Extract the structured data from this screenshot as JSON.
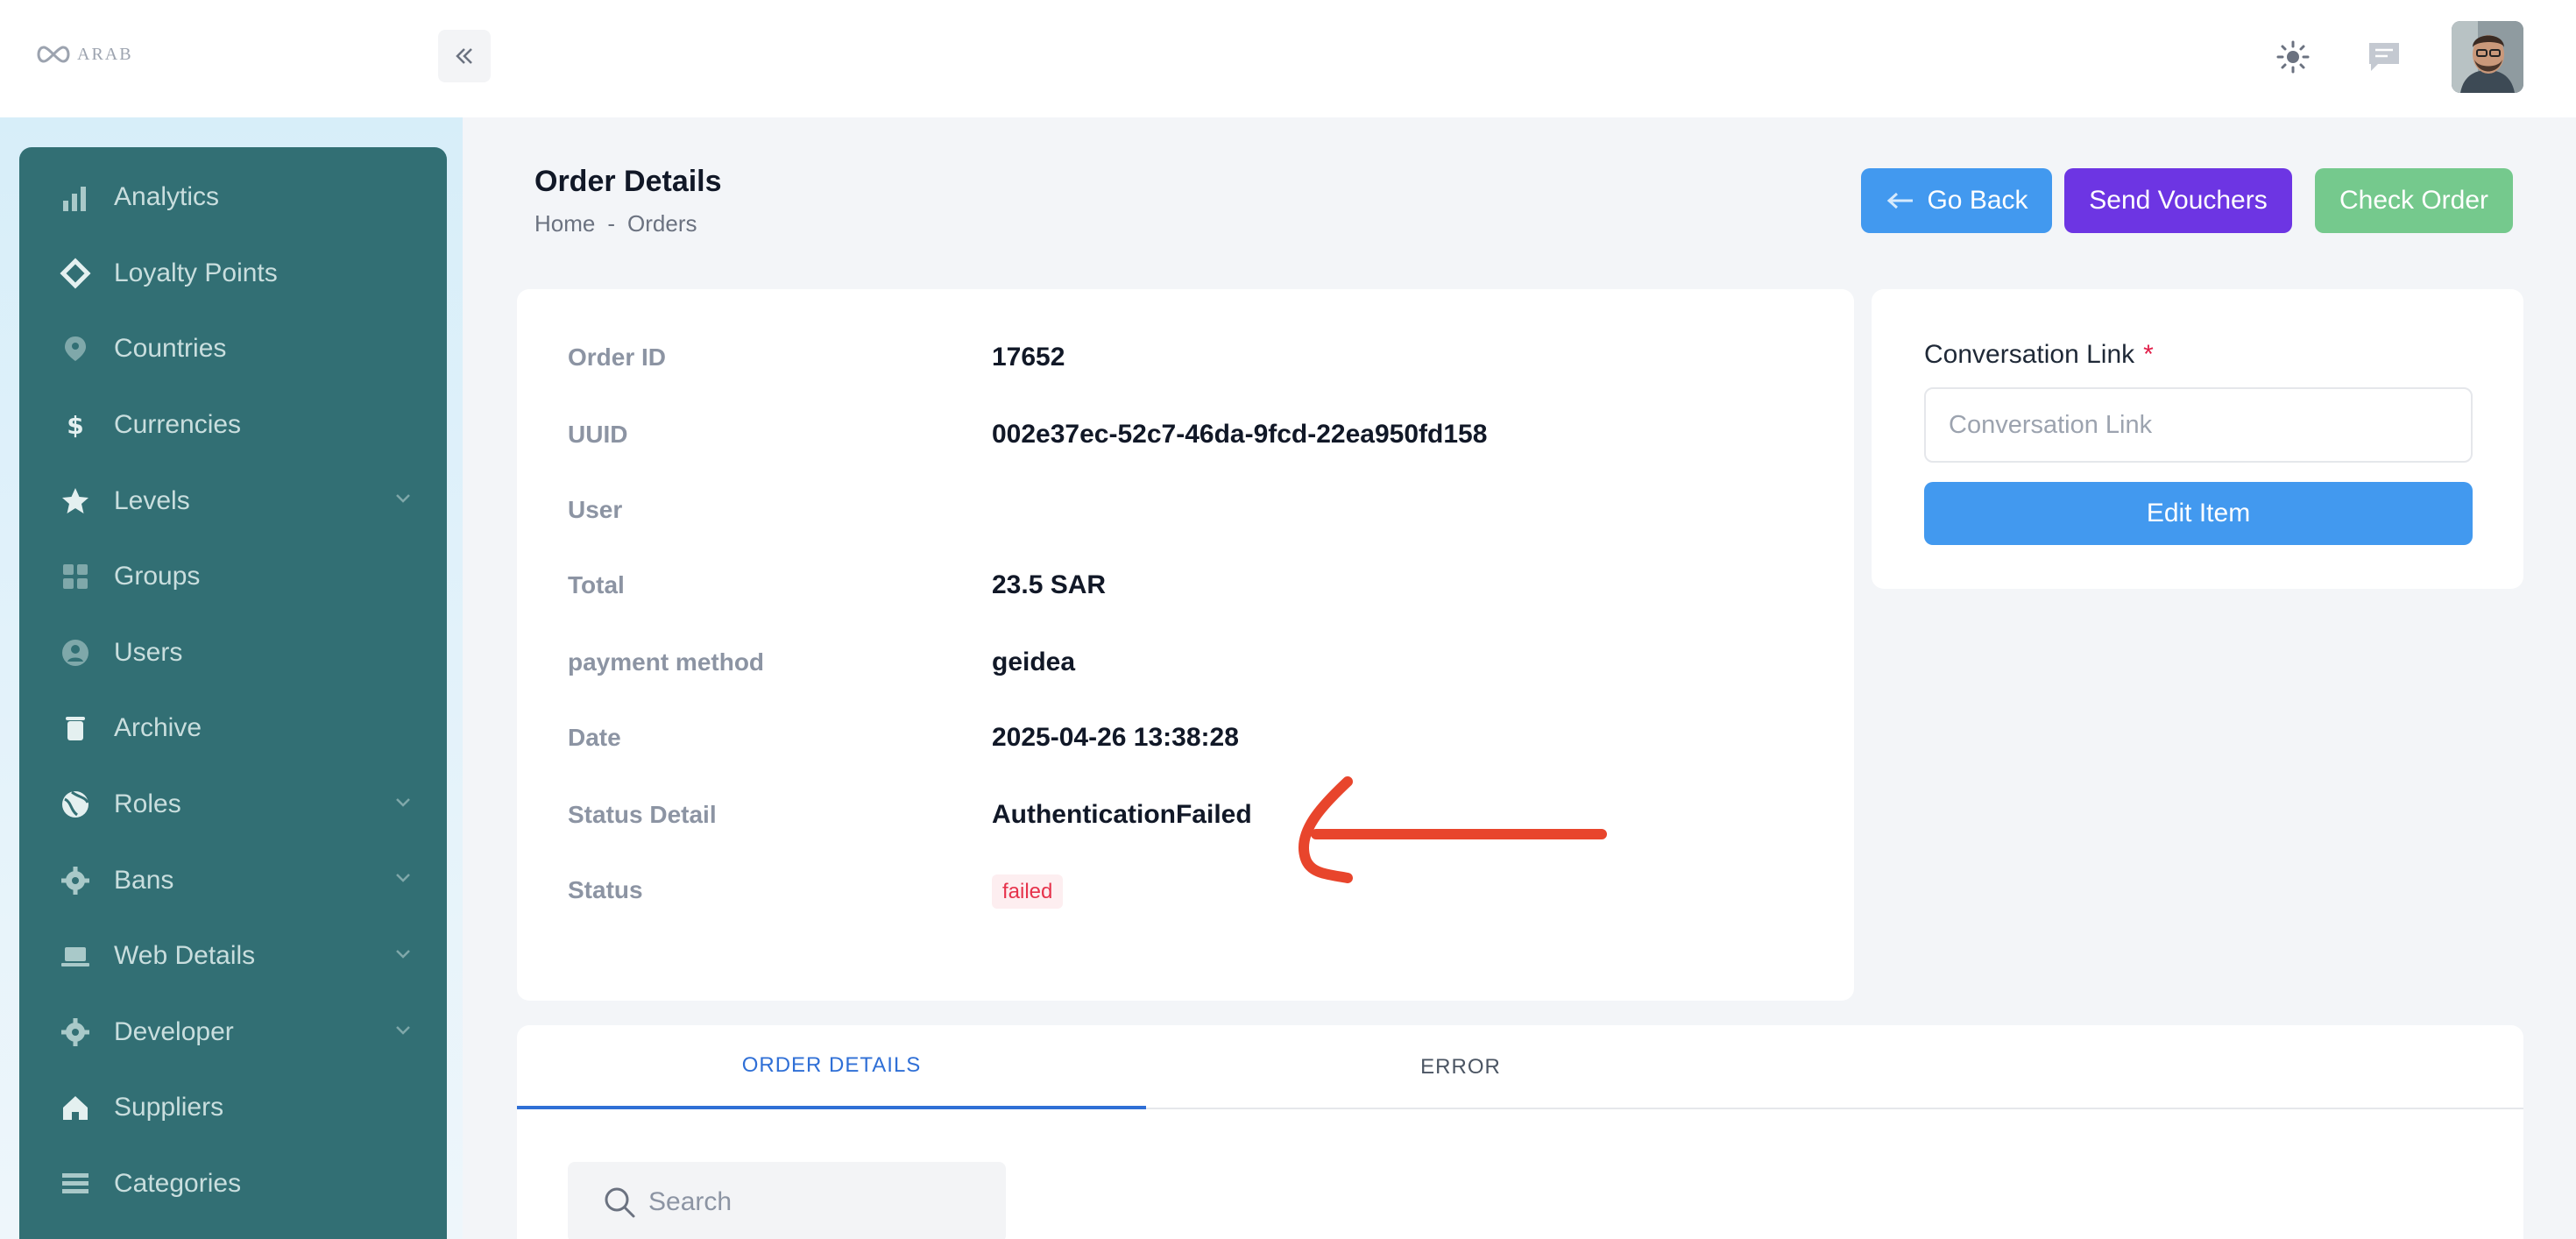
{
  "header": {
    "logo_text": "ARAB",
    "collapse_icon": "double-chevron-left-icon",
    "theme_icon": "sun-icon",
    "messages_icon": "chat-icon"
  },
  "sidebar": {
    "items": [
      {
        "label": "Analytics",
        "icon": "bar-chart-icon",
        "has_submenu": false
      },
      {
        "label": "Loyalty Points",
        "icon": "diamond-icon",
        "has_submenu": false
      },
      {
        "label": "Countries",
        "icon": "map-pin-icon",
        "has_submenu": false
      },
      {
        "label": "Currencies",
        "icon": "dollar-icon",
        "has_submenu": false
      },
      {
        "label": "Levels",
        "icon": "star-icon",
        "has_submenu": true
      },
      {
        "label": "Groups",
        "icon": "grid-icon",
        "has_submenu": false
      },
      {
        "label": "Users",
        "icon": "user-icon",
        "has_submenu": false
      },
      {
        "label": "Archive",
        "icon": "trash-icon",
        "has_submenu": false
      },
      {
        "label": "Roles",
        "icon": "globe-icon",
        "has_submenu": true
      },
      {
        "label": "Bans",
        "icon": "gear-icon",
        "has_submenu": true
      },
      {
        "label": "Web Details",
        "icon": "laptop-icon",
        "has_submenu": true
      },
      {
        "label": "Developer",
        "icon": "gear-icon",
        "has_submenu": true
      },
      {
        "label": "Suppliers",
        "icon": "home-icon",
        "has_submenu": false
      },
      {
        "label": "Categories",
        "icon": "list-icon",
        "has_submenu": false
      }
    ]
  },
  "page": {
    "title": "Order Details",
    "breadcrumb": [
      "Home",
      "-",
      "Orders"
    ]
  },
  "actions": {
    "back": "Go Back",
    "vouchers": "Send Vouchers",
    "check": "Check Order"
  },
  "order": {
    "rows": [
      {
        "label": "Order ID",
        "value": "17652"
      },
      {
        "label": "UUID",
        "value": "002e37ec-52c7-46da-9fcd-22ea950fd158"
      },
      {
        "label": "User",
        "value": ""
      },
      {
        "label": "Total",
        "value": "23.5 SAR"
      },
      {
        "label": "payment method",
        "value": "geidea"
      },
      {
        "label": "Date",
        "value": "2025-04-26 13:38:28"
      },
      {
        "label": "Status Detail",
        "value": "AuthenticationFailed"
      },
      {
        "label": "Status",
        "value": "failed"
      }
    ],
    "status_color": "#e6324b"
  },
  "conversation": {
    "label": "Conversation Link",
    "required_mark": "*",
    "placeholder": "Conversation Link",
    "value": "",
    "button": "Edit Item"
  },
  "tabs": {
    "items": [
      "ORDER DETAILS",
      "ERROR"
    ],
    "active": "ORDER DETAILS"
  },
  "search": {
    "placeholder": "Search"
  },
  "colors": {
    "primary": "#4299ef",
    "vouchers": "#6d35e3",
    "check": "#75c98d",
    "sidebar": "#326f74",
    "annotation": "#e8452c"
  }
}
